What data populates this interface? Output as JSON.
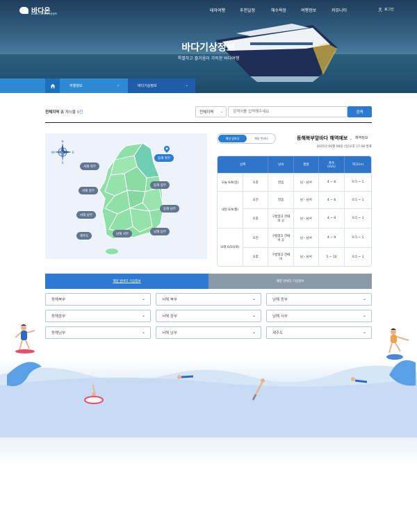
{
  "brand": {
    "name": "바다온",
    "tagline": "BADA-ON 바다기상정보"
  },
  "nav": {
    "items": [
      "테마여행",
      "추천일정",
      "해수욕장",
      "여행정보",
      "커뮤니티"
    ],
    "login": "로그인"
  },
  "hero": {
    "title": "바다기상정보",
    "subtitle": "특별하고 즐거움이 가득한 바다여행"
  },
  "breadcrumb": {
    "level1": "여행정보",
    "level2": "바다기상정보"
  },
  "list": {
    "count_label_prefix": "전체지역",
    "count_label_mid": "총 게시물",
    "count_value": "0건"
  },
  "search": {
    "scope": "전체지역",
    "placeholder": "검색어를 입력해주세요",
    "button": "검색"
  },
  "map": {
    "regions": [
      {
        "label": "동해 북부",
        "active": true
      },
      {
        "label": "서해 북부",
        "active": false
      },
      {
        "label": "서해 중부",
        "active": false
      },
      {
        "label": "동해 중부",
        "active": false
      },
      {
        "label": "동해 남부",
        "active": false
      },
      {
        "label": "서해 남부",
        "active": false
      },
      {
        "label": "남해 서부",
        "active": false
      },
      {
        "label": "남해 동부",
        "active": false
      },
      {
        "label": "제주도",
        "active": false
      }
    ],
    "compass": {
      "n": "N",
      "s": "S",
      "w": "W",
      "e": "E"
    }
  },
  "forecast_toggle": {
    "on": "해양 앞바다",
    "off": "해양 먼바다"
  },
  "forecast": {
    "title": "동해북부앞바다 해역예보",
    "subtitle": "해역정보",
    "timestamp": "2025년 06월 08일 (일)오후 17:00 발표",
    "headers": [
      "날짜",
      "",
      "날씨",
      "풍향",
      "풍속(m/s)",
      "파고(m)"
    ],
    "header_wind_speed_line1": "풍속",
    "header_wind_speed_line2": "(m/s)",
    "rows": [
      {
        "date": "오늘 6/8(일)",
        "period": "오후",
        "weather": "맑음",
        "dir": "남 - 남서",
        "speed": "4 ~ 8",
        "wave": "0.5 ~ 1"
      },
      {
        "date": "내일 6/9(월)",
        "period": "오전",
        "weather": "맑음",
        "dir": "남 - 남서",
        "speed": "4 ~ 8",
        "wave": "0.5 ~ 1"
      },
      {
        "date": "",
        "period": "오후",
        "weather": "구름많고 한때 비 곳",
        "dir": "남 - 남서",
        "speed": "4 ~ 8",
        "wave": "0.5 ~ 1"
      },
      {
        "date": "모레 6/10(화)",
        "period": "오전",
        "weather": "구름많고 한때 비 곳",
        "dir": "남 - 남서",
        "speed": "4 ~ 9",
        "wave": "0.5 ~ 1"
      },
      {
        "date": "",
        "period": "오후",
        "weather": "구름많고 한때 비",
        "dir": "남 - 남서",
        "speed": "5 ~ 10",
        "wave": "0.5 ~ 1"
      }
    ]
  },
  "bottom_tabs": {
    "active": "해양 앞바다 기상정보",
    "inactive": "해양 먼바다 기상정보"
  },
  "dropdowns": [
    "동해북부",
    "서해 북부",
    "남해 동부",
    "동해중부",
    "서해 중부",
    "남해 서부",
    "동해남부",
    "서해 남부",
    "제주도"
  ]
}
